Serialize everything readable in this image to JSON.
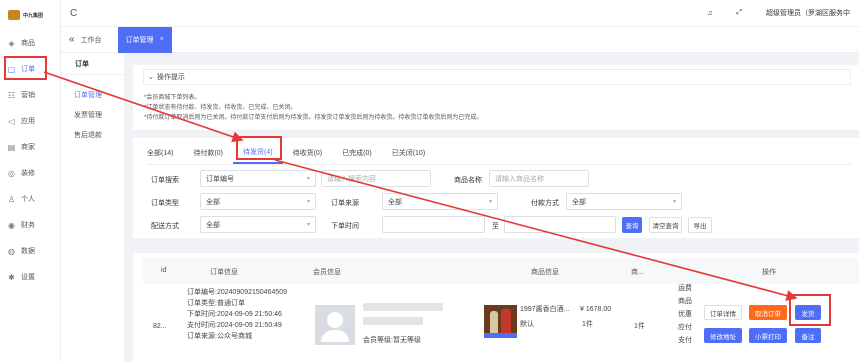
{
  "brand": {
    "logo_text": "中九集团"
  },
  "nav": {
    "items": [
      {
        "label": "商品",
        "icon": "goods-icon"
      },
      {
        "label": "订单",
        "icon": "order-icon",
        "active": true
      },
      {
        "label": "营销",
        "icon": "marketing-icon"
      },
      {
        "label": "应用",
        "icon": "app-icon"
      },
      {
        "label": "商家",
        "icon": "merchant-icon"
      },
      {
        "label": "装修",
        "icon": "decor-icon"
      },
      {
        "label": "个人",
        "icon": "person-icon"
      },
      {
        "label": "财务",
        "icon": "finance-icon"
      },
      {
        "label": "数据",
        "icon": "data-icon"
      },
      {
        "label": "设置",
        "icon": "settings-icon"
      }
    ]
  },
  "header": {
    "refresh_glyph": "C",
    "bell_glyph": "♫",
    "fullscreen_glyph": "⤢",
    "user": "超级管理员（罗湖区服务中"
  },
  "tabs": {
    "collapse_glyph": "«",
    "workspace": "工作台",
    "active_tab": "订单管理",
    "close_glyph": "×"
  },
  "subnav": {
    "title": "订单",
    "items": [
      {
        "label": "订单管理",
        "active": true
      },
      {
        "label": "发票管理"
      },
      {
        "label": "售后退款"
      }
    ]
  },
  "tips": {
    "title": "操作提示",
    "lines": [
      "*会员商城下单列表。",
      "*订单状态有待付款、待发货、待收货、已完成、已关闭。",
      "*待付款订单取消后则为已关闭。待付款订单支付后则为待发货。待发货订单发货后则为待收货。待收货订单收货后则为已完成。"
    ]
  },
  "status_tabs": [
    "全部(14)",
    "待付款(0)",
    "待发货(4)",
    "待收货(0)",
    "已完成(0)",
    "已关闭(10)"
  ],
  "filters": {
    "order_search_label": "订单搜索",
    "order_search_value": "订单编号",
    "order_search_placeholder": "请输入搜索内容",
    "product_name_label": "商品名称",
    "product_name_placeholder": "请输入商品名称",
    "order_type_label": "订单类型",
    "order_type_value": "全部",
    "order_source_label": "订单来源",
    "order_source_value": "全部",
    "pay_method_label": "付款方式",
    "pay_method_value": "全部",
    "delivery_label": "配送方式",
    "delivery_value": "全部",
    "order_time_label": "下单时间",
    "date_separator": "至",
    "search_button": "查询",
    "reset_button": "清空查询",
    "export_button": "导出"
  },
  "table": {
    "headers": [
      "id",
      "订单信息",
      "会员信息",
      "商品信息",
      "商...",
      "操作"
    ],
    "row": {
      "id": "82...",
      "order_lines": [
        "订单编号:202409092150464509",
        "订单类型:普通订单",
        "下单时间:2024-09-09 21:50:46",
        "支付时间:2024-09-09 21:50:49",
        "订单来源:公众号商城"
      ],
      "member_level": "会员等级:暂无等级",
      "product_name": "1997酱香白酒...",
      "product_spec": "默认",
      "price": "¥ 1678.00",
      "qty": "1件",
      "total_qty": "1件",
      "fee_labels": [
        "运费",
        "商品",
        "优惠",
        "应付",
        "支付"
      ],
      "actions": {
        "detail": "订单详情",
        "cancel": "取消订单",
        "ship": "发货",
        "edit_address": "修改地址",
        "print": "小票打印",
        "remark": "备注"
      }
    }
  },
  "colors": {
    "primary": "#4f6ef7",
    "orange": "#ff6a1a",
    "annotation_red": "#e53935"
  }
}
